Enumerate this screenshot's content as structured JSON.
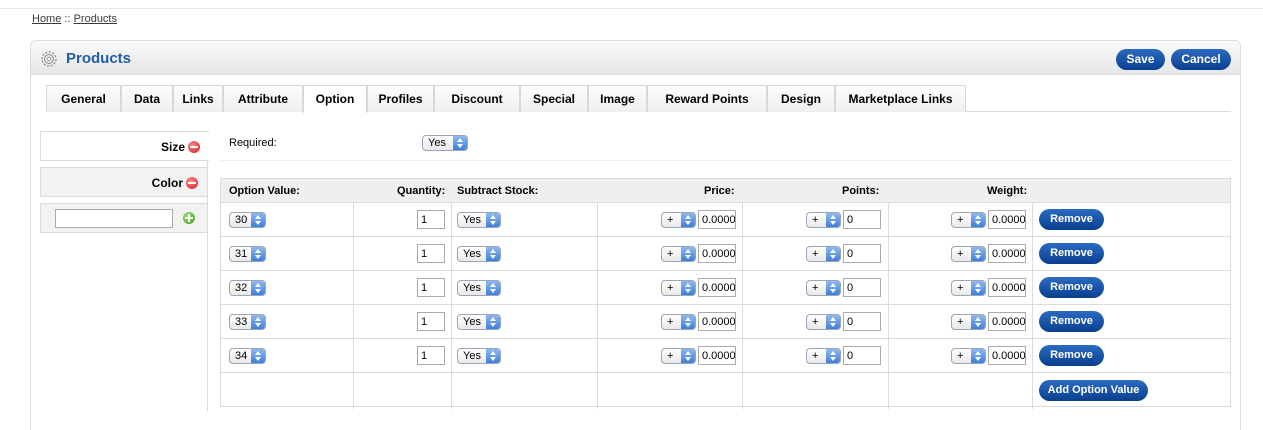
{
  "breadcrumb": {
    "home": "Home",
    "separator": " :: ",
    "current": "Products"
  },
  "heading": {
    "title": "Products",
    "icon": "gear-icon",
    "save_label": "Save",
    "cancel_label": "Cancel"
  },
  "tabs": [
    "General",
    "Data",
    "Links",
    "Attribute",
    "Option",
    "Profiles",
    "Discount",
    "Special",
    "Image",
    "Reward Points",
    "Design",
    "Marketplace Links"
  ],
  "active_tab": "Option",
  "options": [
    {
      "label": "Size",
      "active": true
    },
    {
      "label": "Color",
      "active": false
    }
  ],
  "add_option": {
    "value": ""
  },
  "required": {
    "label": "Required:",
    "value": "Yes"
  },
  "table": {
    "headers": {
      "option_value": "Option Value:",
      "quantity": "Quantity:",
      "subtract": "Subtract Stock:",
      "price": "Price:",
      "points": "Points:",
      "weight": "Weight:"
    },
    "rows": [
      {
        "value": "30",
        "qty": "1",
        "subtract": "Yes",
        "price_prefix": "+",
        "price": "0.0000",
        "points_prefix": "+",
        "points": "0",
        "weight_prefix": "+",
        "weight": "0.0000"
      },
      {
        "value": "31",
        "qty": "1",
        "subtract": "Yes",
        "price_prefix": "+",
        "price": "0.0000",
        "points_prefix": "+",
        "points": "0",
        "weight_prefix": "+",
        "weight": "0.0000"
      },
      {
        "value": "32",
        "qty": "1",
        "subtract": "Yes",
        "price_prefix": "+",
        "price": "0.0000",
        "points_prefix": "+",
        "points": "0",
        "weight_prefix": "+",
        "weight": "0.0000"
      },
      {
        "value": "33",
        "qty": "1",
        "subtract": "Yes",
        "price_prefix": "+",
        "price": "0.0000",
        "points_prefix": "+",
        "points": "0",
        "weight_prefix": "+",
        "weight": "0.0000"
      },
      {
        "value": "34",
        "qty": "1",
        "subtract": "Yes",
        "price_prefix": "+",
        "price": "0.0000",
        "points_prefix": "+",
        "points": "0",
        "weight_prefix": "+",
        "weight": "0.0000"
      }
    ],
    "remove_label": "Remove",
    "add_value_label": "Add Option Value"
  },
  "colors": {
    "accent": "#1f5ea8",
    "button": "#0a3f8e",
    "remove": "#d11a1a",
    "add": "#3f9d1c"
  }
}
